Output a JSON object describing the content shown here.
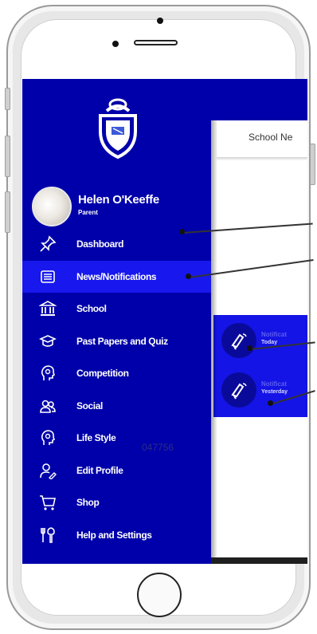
{
  "drawer": {
    "profile": {
      "name": "Helen O'Keeffe",
      "role": "Parent"
    },
    "menu": [
      {
        "label": "Dashboard",
        "icon": "pin-icon"
      },
      {
        "label": "News/Notifications",
        "icon": "news-icon",
        "active": true
      },
      {
        "label": "School",
        "icon": "school-icon"
      },
      {
        "label": "Past Papers and Quiz",
        "icon": "cap-icon"
      },
      {
        "label": "Competition",
        "icon": "head-icon"
      },
      {
        "label": "Social",
        "icon": "users-icon"
      },
      {
        "label": "Life Style",
        "icon": "head-icon"
      },
      {
        "label": "Edit Profile",
        "icon": "user-edit-icon"
      },
      {
        "label": "Shop",
        "icon": "cart-icon"
      },
      {
        "label": "Help and Settings",
        "icon": "tools-icon"
      }
    ],
    "watermark": "047756"
  },
  "app": {
    "tab_label": "School Ne",
    "notifications": [
      {
        "title": "Notificat",
        "time": "Today"
      },
      {
        "title": "Notificat",
        "time": "Yesterday"
      }
    ]
  },
  "colors": {
    "drawer_bg": "#0000aa",
    "active_bg": "#1717ee",
    "panel_bg": "#1414e6"
  }
}
